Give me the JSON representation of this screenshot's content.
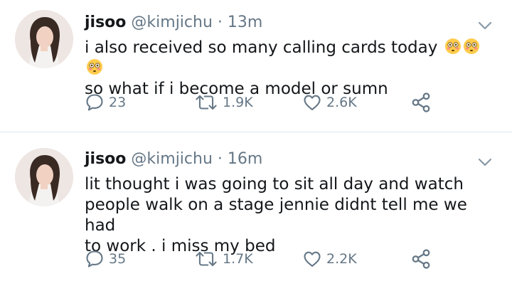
{
  "tweets": [
    {
      "name": "jisoo",
      "handle": "@kimjichu",
      "dot": "·",
      "time": "13m",
      "text_lines": [
        "i also received so many calling cards today",
        "so what if i become a model or sumn"
      ],
      "emojis": [
        "flushed-face",
        "flushed-face",
        "flushed-face"
      ],
      "replies": "23",
      "retweets": "1.9K",
      "likes": "2.6K"
    },
    {
      "name": "jisoo",
      "handle": "@kimjichu",
      "dot": "·",
      "time": "16m",
      "text_lines": [
        "lit thought i was going to sit all day and watch",
        "people walk on a stage jennie didnt tell me we had",
        "to work . i miss my bed"
      ],
      "replies": "35",
      "retweets": "1.7K",
      "likes": "2.2K"
    }
  ],
  "icons": {
    "reply": "reply-icon",
    "retweet": "retweet-icon",
    "like": "heart-icon",
    "share": "share-icon",
    "caret": "chevron-down-icon"
  },
  "colors": {
    "text": "#14171a",
    "muted": "#657786",
    "divider": "#e1e8ed"
  }
}
